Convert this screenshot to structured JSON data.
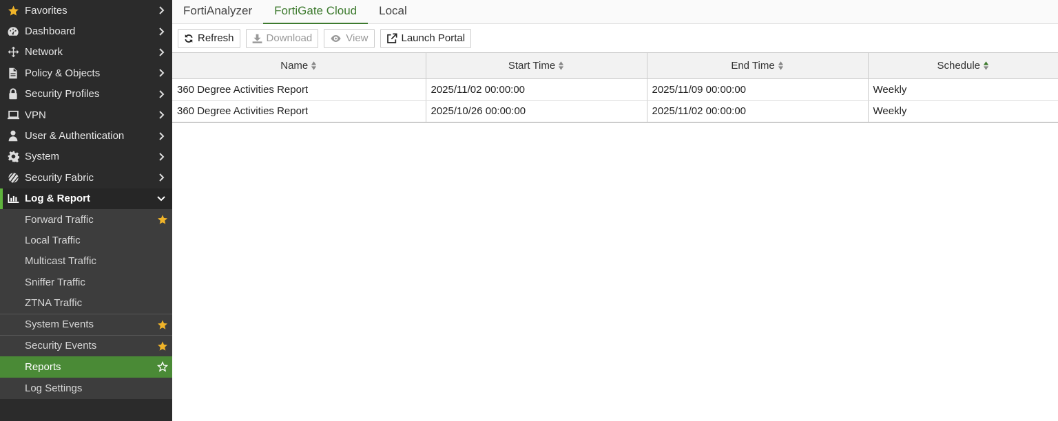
{
  "sidebar": {
    "items": [
      {
        "label": "Favorites",
        "icon": "star-icon"
      },
      {
        "label": "Dashboard",
        "icon": "dashboard-icon"
      },
      {
        "label": "Network",
        "icon": "network-icon"
      },
      {
        "label": "Policy & Objects",
        "icon": "policy-icon"
      },
      {
        "label": "Security Profiles",
        "icon": "lock-icon"
      },
      {
        "label": "VPN",
        "icon": "laptop-icon"
      },
      {
        "label": "User & Authentication",
        "icon": "user-icon"
      },
      {
        "label": "System",
        "icon": "gear-icon"
      },
      {
        "label": "Security Fabric",
        "icon": "fabric-icon"
      },
      {
        "label": "Log & Report",
        "icon": "chart-icon"
      }
    ],
    "subitems": [
      {
        "label": "Forward Traffic",
        "favorite": true
      },
      {
        "label": "Local Traffic"
      },
      {
        "label": "Multicast Traffic"
      },
      {
        "label": "Sniffer Traffic"
      },
      {
        "label": "ZTNA Traffic"
      },
      {
        "label": "System Events",
        "favorite": true
      },
      {
        "label": "Security Events",
        "favorite": true
      },
      {
        "label": "Reports",
        "favorite": false,
        "active": true
      },
      {
        "label": "Log Settings"
      }
    ]
  },
  "tabs": [
    "FortiAnalyzer",
    "FortiGate Cloud",
    "Local"
  ],
  "active_tab": "FortiGate Cloud",
  "toolbar": {
    "refresh": "Refresh",
    "download": "Download",
    "view": "View",
    "launch_portal": "Launch Portal"
  },
  "table": {
    "columns": [
      "Name",
      "Start Time",
      "End Time",
      "Schedule"
    ],
    "rows": [
      [
        "360 Degree Activities Report",
        "2025/11/02 00:00:00",
        "2025/11/09 00:00:00",
        "Weekly"
      ],
      [
        "360 Degree Activities Report",
        "2025/10/26 00:00:00",
        "2025/11/02 00:00:00",
        "Weekly"
      ]
    ]
  },
  "colors": {
    "accent": "#3d7a2e",
    "active_bg": "#4a8a36",
    "star": "#f0b429",
    "sidebar_bg": "#2b2b2b"
  }
}
